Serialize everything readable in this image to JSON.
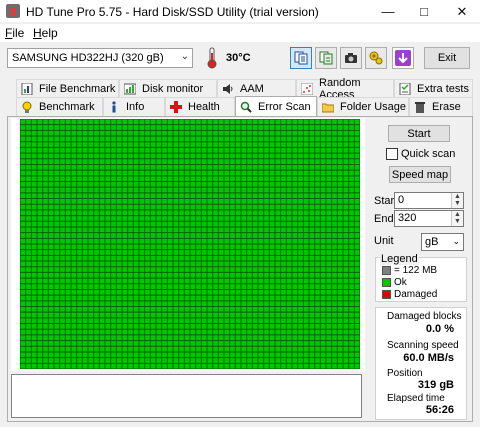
{
  "window": {
    "title": "HD Tune Pro 5.75 - Hard Disk/SSD Utility (trial version)"
  },
  "menu": {
    "file": "File",
    "file_key": "F",
    "help": "Help",
    "help_key": "H"
  },
  "toolbar": {
    "drive": "SAMSUNG HD322HJ (320 gB)",
    "temperature": "30°C",
    "exit_label": "Exit",
    "icons": [
      "copy-text-icon",
      "copy-info-icon",
      "camera-icon",
      "settings-icon",
      "download-icon"
    ]
  },
  "tabs": {
    "row1": [
      "File Benchmark",
      "Disk monitor",
      "AAM",
      "Random Access",
      "Extra tests"
    ],
    "row2": [
      "Benchmark",
      "Info",
      "Health",
      "Error Scan",
      "Folder Usage",
      "Erase"
    ],
    "selected": "Error Scan"
  },
  "scan": {
    "start_label": "Start",
    "quick_scan_label": "Quick scan",
    "quick_scan_checked": false,
    "speed_map_label": "Speed map",
    "start_field_label": "Start",
    "start_value": "0",
    "end_field_label": "End",
    "end_value": "320",
    "unit_label": "Unit",
    "unit_value": "gB"
  },
  "legend": {
    "title": "Legend",
    "items": [
      {
        "color": "#808080",
        "label": "= 122 MB"
      },
      {
        "color": "#00c800",
        "label": "Ok"
      },
      {
        "color": "#e00000",
        "label": "Damaged"
      }
    ]
  },
  "stats": {
    "damaged_label": "Damaged blocks",
    "damaged_value": "0.0 %",
    "speed_label": "Scanning speed",
    "speed_value": "60.0 MB/s",
    "position_label": "Position",
    "position_value": "319 gB",
    "elapsed_label": "Elapsed time",
    "elapsed_value": "56:26"
  },
  "grid": {
    "block_color": "#00c800",
    "line_color": "#006400",
    "status": "all blocks ok"
  }
}
